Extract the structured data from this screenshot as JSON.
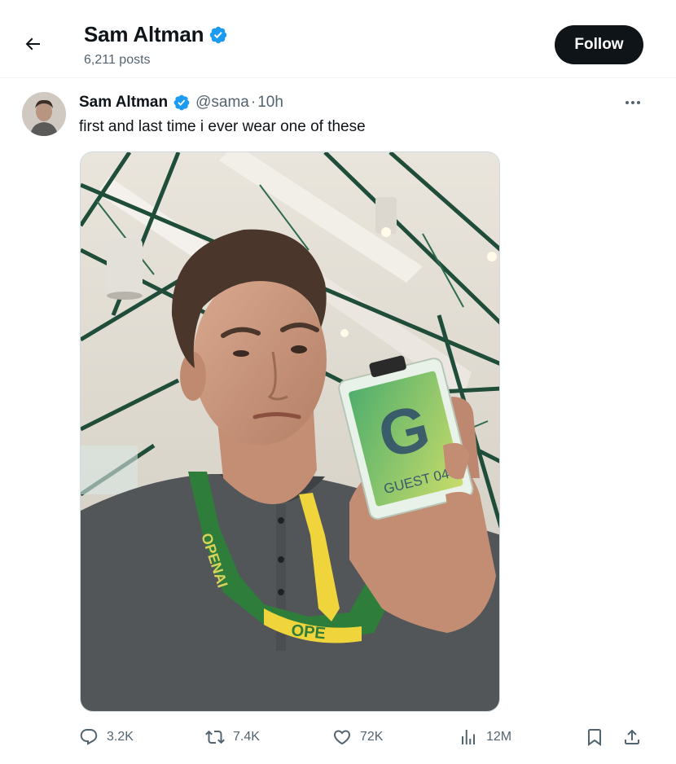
{
  "header": {
    "name": "Sam Altman",
    "posts": "6,211 posts",
    "follow_label": "Follow"
  },
  "tweet": {
    "author": "Sam Altman",
    "handle": "@sama",
    "separator": "·",
    "time": "10h",
    "text": "first and last time i ever wear one of these",
    "badge_text": "GUEST 04",
    "badge_letter": "G",
    "lanyard_text": "OPENAI"
  },
  "actions": {
    "replies": "3.2K",
    "reposts": "7.4K",
    "likes": "72K",
    "views": "12M"
  },
  "colors": {
    "verified": "#1d9bf0",
    "follow_bg": "#0f1419",
    "secondary_text": "#536471"
  },
  "icons": [
    "back-arrow-icon",
    "verified-badge-icon",
    "more-icon",
    "reply-icon",
    "repost-icon",
    "like-icon",
    "views-icon",
    "bookmark-icon",
    "share-icon"
  ]
}
